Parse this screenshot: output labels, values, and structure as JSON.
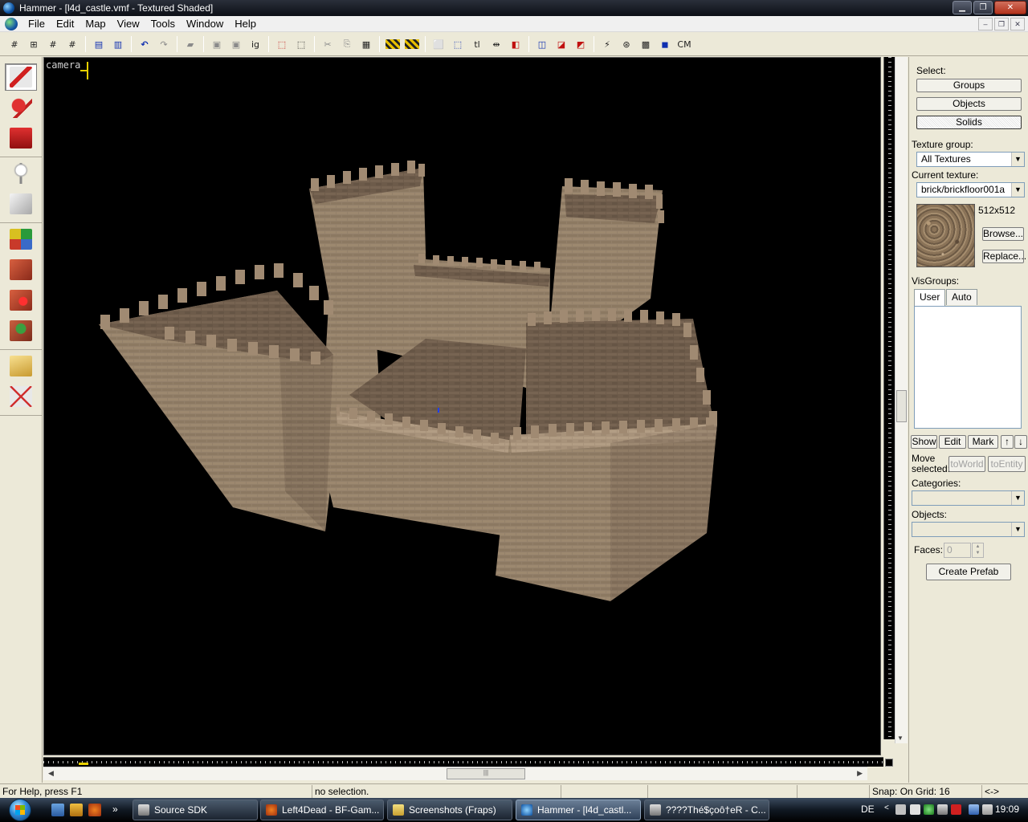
{
  "window": {
    "title": "Hammer - [l4d_castle.vmf - Textured Shaded]"
  },
  "menu": {
    "items": [
      "File",
      "Edit",
      "Map",
      "View",
      "Tools",
      "Window",
      "Help"
    ]
  },
  "toolbar": {
    "tl_label": "tl",
    "cm_label": "CM",
    "ig_label": "ig"
  },
  "viewport": {
    "label": "camera"
  },
  "right_panel": {
    "select_label": "Select:",
    "groups_button": "Groups",
    "objects_button": "Objects",
    "solids_button": "Solids",
    "texture_group_label": "Texture group:",
    "texture_group_value": "All Textures",
    "current_texture_label": "Current texture:",
    "current_texture_value": "brick/brickfloor001a",
    "texture_size": "512x512",
    "browse_button": "Browse...",
    "replace_button": "Replace...",
    "visgroups_label": "VisGroups:",
    "tab_user": "User",
    "tab_auto": "Auto",
    "show_button": "Show",
    "edit_button": "Edit",
    "mark_button": "Mark",
    "move_selected_label_1": "Move",
    "move_selected_label_2": "selected:",
    "to_world_button": "toWorld",
    "to_entity_button": "toEntity",
    "categories_label": "Categories:",
    "objects_label": "Objects:",
    "faces_label": "Faces:",
    "faces_value": "0",
    "create_prefab_button": "Create Prefab"
  },
  "statusbar": {
    "help": "For Help, press F1",
    "selection": "no selection.",
    "snap": "Snap: On Grid: 16",
    "extra": "<->"
  },
  "taskbar": {
    "buttons": [
      "Source SDK",
      "Left4Dead - BF-Gam...",
      "Screenshots (Fraps)",
      "Hammer - [l4d_castl...",
      "????Thé$çoô†eR - C..."
    ],
    "language": "DE",
    "clock": "19:09"
  },
  "colors": {
    "stone_light": "#a08a72",
    "stone_mid": "#8a7560",
    "stone_dark": "#6a5948",
    "viewport_bg": "#000000"
  }
}
